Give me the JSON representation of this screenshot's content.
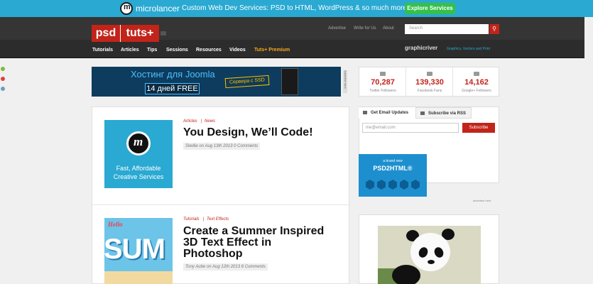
{
  "promo": {
    "brand": "microlancer",
    "tagline": "Custom Web Dev Services: PSD to HTML, WordPress & so much more!",
    "cta": "Explore Services"
  },
  "header": {
    "logo_part1": "psd",
    "logo_part2": "tuts+",
    "top_links": [
      "Advertise",
      "Write for Us",
      "About"
    ],
    "search_placeholder": "Search",
    "nav": [
      "Tutorials",
      "Articles",
      "Tips",
      "Sessions",
      "Resources",
      "Videos",
      "Tuts+ Premium"
    ],
    "partner": "graphicriver",
    "partner_tagline": "Graphics, Vectors and Print"
  },
  "ad_banner": {
    "line1": "Хостинг для Joomla",
    "line2": "14 дней FREE",
    "badge": "Сервера с SSD",
    "label": "Advertise here"
  },
  "social": [
    {
      "count": "70,287",
      "label": "Twitter Followers",
      "icon": "twitter-icon"
    },
    {
      "count": "139,330",
      "label": "Facebook Fans",
      "icon": "facebook-icon"
    },
    {
      "count": "14,162",
      "label": "Google+ Followers",
      "icon": "google-plus-icon"
    }
  ],
  "posts": [
    {
      "cat1": "Articles",
      "cat2": "News",
      "title": "You Design, We’ll Code!",
      "meta": "Skellie on Aug 13th 2013 0 Comments",
      "thumb_caption": "Fast, Affordable Creative Services"
    },
    {
      "cat1": "Tutorials",
      "cat2": "Text Effects",
      "title": "Create a Summer Inspired 3D Text Effect in Photoshop",
      "meta": "Tony Aube on Aug 12th 2013 6 Comments",
      "thumb_hello": "Hello",
      "thumb_big": "SUM"
    }
  ],
  "subscribe": {
    "tab_email": "Get Email Updates",
    "tab_rss": "Subscribe via RSS",
    "email_placeholder": "me@email.com",
    "button": "Subscribe"
  },
  "side_ad": {
    "line1": "a brand new",
    "line2": "PSD2HTML®",
    "advertise": "advertise here"
  }
}
